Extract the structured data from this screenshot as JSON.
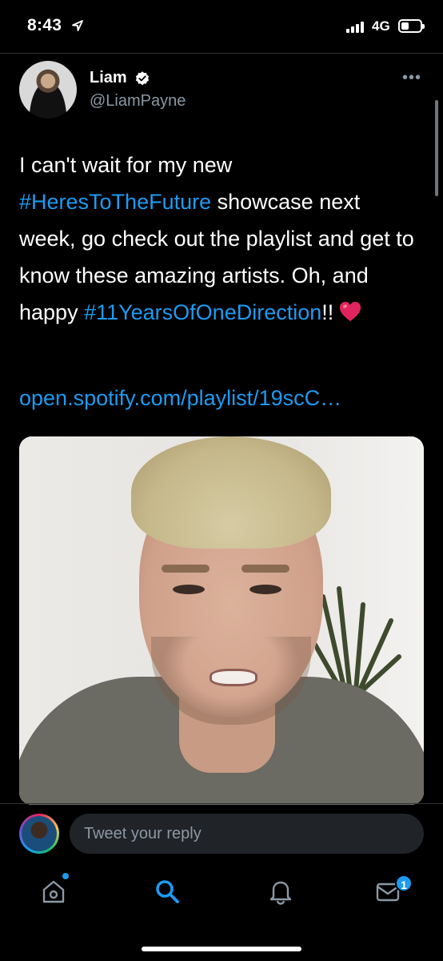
{
  "status_bar": {
    "time": "8:43",
    "network": "4G"
  },
  "tweet": {
    "author_name": "Liam",
    "author_handle": "@LiamPayne",
    "more_label": "•••",
    "text_parts": {
      "p1": "I can't wait for my new ",
      "hashtag1": "#HeresToTheFuture",
      "p2": " showcase next week, go check out the playlist and get to know these amazing artists. Oh, and happy ",
      "hashtag2": "#11YearsOfOneDirection",
      "p3": "!!"
    },
    "link": "open.spotify.com/playlist/19scC…"
  },
  "reply": {
    "placeholder": "Tweet your reply"
  },
  "nav": {
    "items": [
      {
        "name": "home",
        "icon": "home-icon"
      },
      {
        "name": "search",
        "icon": "search-icon",
        "active": true
      },
      {
        "name": "notifications",
        "icon": "bell-icon"
      },
      {
        "name": "messages",
        "icon": "mail-icon"
      }
    ],
    "messages_badge": "1"
  },
  "colors": {
    "accent": "#1d9bf0",
    "background": "#000000",
    "secondary_text": "#8b98a5"
  }
}
